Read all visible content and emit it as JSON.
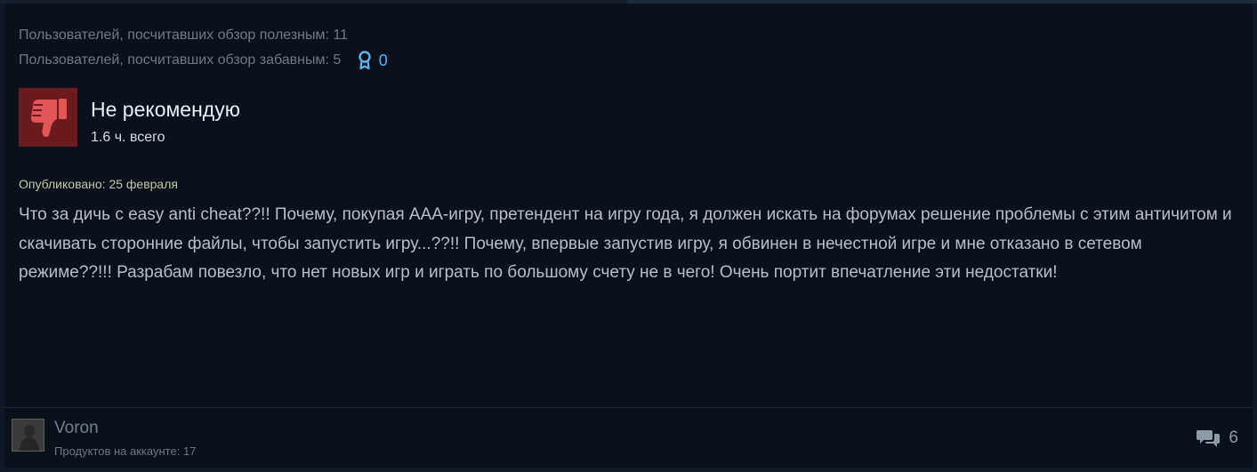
{
  "votes": {
    "helpful": "Пользователей, посчитавших обзор полезным: 11",
    "funny": "Пользователей, посчитавших обзор забавным: 5",
    "awards": "0"
  },
  "recommendation": {
    "title": "Не рекомендую",
    "hours": "1.6 ч. всего",
    "icon": "thumbs-down-icon"
  },
  "review": {
    "posted": "Опубликовано: 25 февраля",
    "text": "Что за дичь с easy anti cheat??!! Почему, покупая AAA-игру, претендент на игру года, я должен искать на форумах решение проблемы с этим античитом и скачивать сторонние файлы, чтобы запустить игру...??!! Почему, впервые запустив игру, я обвинен в нечестной игре и мне отказано в сетевом режиме??!!! Разрабам повезло, что нет новых игр и играть по большому счету не в чего! Очень портит впечатление эти недостатки!"
  },
  "author": {
    "name": "Voron",
    "products": "Продуктов на аккаунте: 17"
  },
  "comments": {
    "count": "6",
    "icon": "comments-icon"
  },
  "colors": {
    "background": "#0b111b",
    "award_blue": "#5db3ef",
    "thumb_bg": "#6b1b1e",
    "thumb_fg": "#e25656"
  }
}
